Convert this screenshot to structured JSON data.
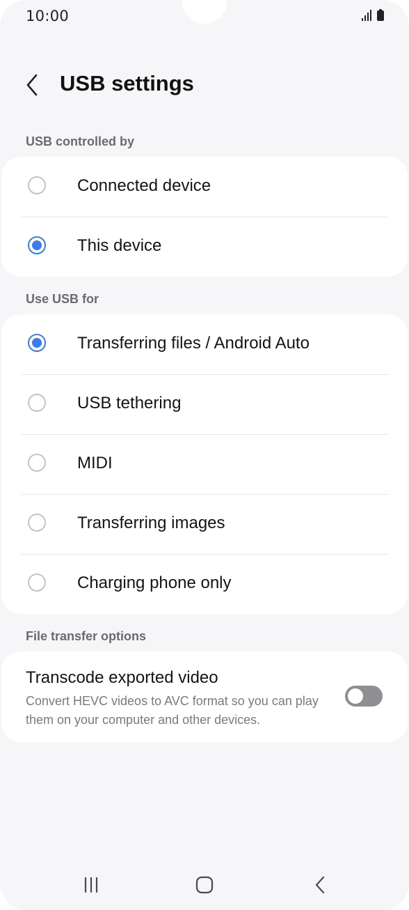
{
  "status_bar": {
    "time": "10:00"
  },
  "header": {
    "title": "USB settings",
    "back_icon": "chevron-left-icon"
  },
  "sections": [
    {
      "title": "USB controlled by",
      "options": [
        {
          "label": "Connected device",
          "selected": false
        },
        {
          "label": "This device",
          "selected": true
        }
      ]
    },
    {
      "title": "Use USB for",
      "options": [
        {
          "label": "Transferring files / Android Auto",
          "selected": true
        },
        {
          "label": "USB tethering",
          "selected": false
        },
        {
          "label": "MIDI",
          "selected": false
        },
        {
          "label": "Transferring images",
          "selected": false
        },
        {
          "label": "Charging phone only",
          "selected": false
        }
      ]
    },
    {
      "title": "File transfer options",
      "toggle": {
        "title": "Transcode exported video",
        "description": "Convert HEVC videos to AVC format so you can play them on your computer and other devices.",
        "enabled": false
      }
    }
  ],
  "colors": {
    "accent": "#3a7bf0",
    "background": "#f6f6f8",
    "card": "#ffffff",
    "toggle_off": "#8f8f93"
  },
  "nav_bar": {
    "icons": [
      "recent-apps-icon",
      "home-icon",
      "back-icon"
    ]
  }
}
